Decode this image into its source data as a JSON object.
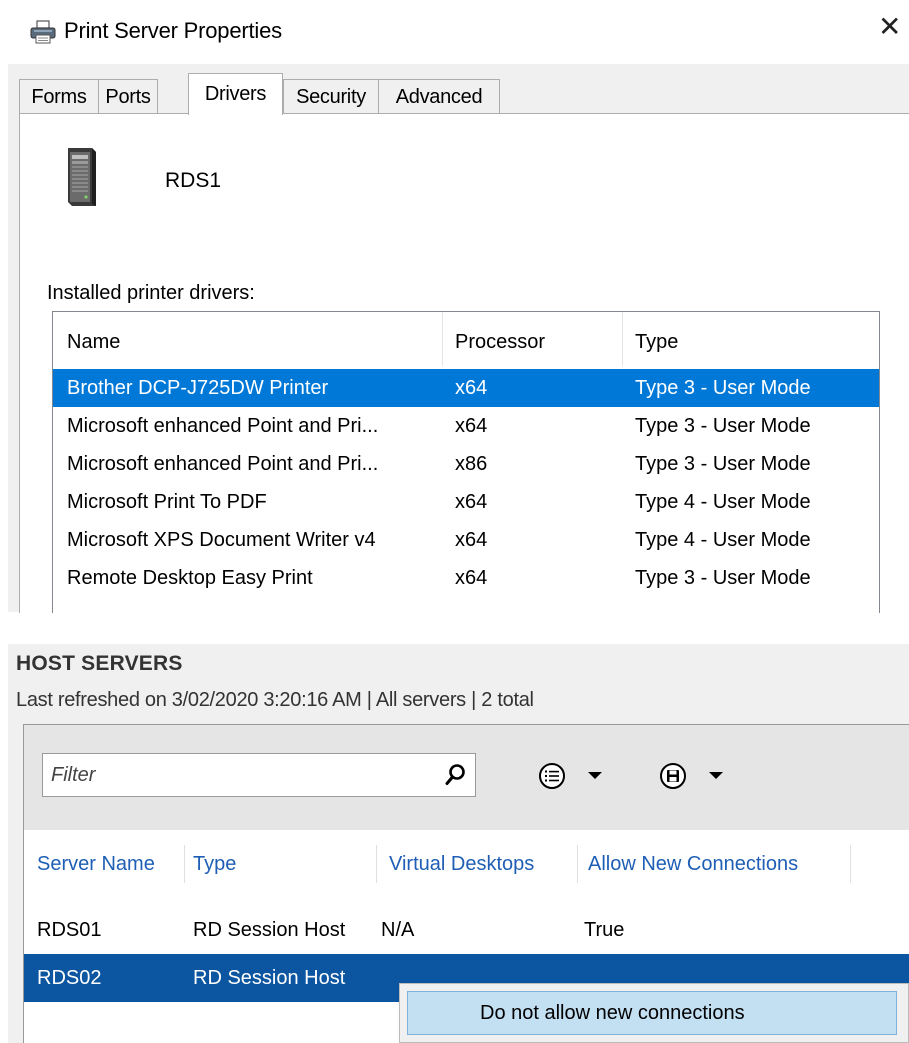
{
  "dialog": {
    "title": "Print Server Properties",
    "close_glyph": "✕",
    "tabs": [
      "Forms",
      "Ports",
      "Drivers",
      "Security",
      "Advanced"
    ],
    "active_tab": "Drivers",
    "server_name": "RDS1",
    "installed_label": "Installed printer drivers:",
    "columns": [
      "Name",
      "Processor",
      "Type"
    ],
    "drivers": [
      {
        "name": "Brother DCP-J725DW Printer",
        "processor": "x64",
        "type": "Type 3 - User Mode",
        "selected": true
      },
      {
        "name": "Microsoft enhanced Point and Pri...",
        "processor": "x64",
        "type": "Type 3 - User Mode"
      },
      {
        "name": "Microsoft enhanced Point and Pri...",
        "processor": "x86",
        "type": "Type 3 - User Mode"
      },
      {
        "name": "Microsoft Print To PDF",
        "processor": "x64",
        "type": "Type 4 - User Mode"
      },
      {
        "name": "Microsoft XPS Document Writer v4",
        "processor": "x64",
        "type": "Type 4 - User Mode"
      },
      {
        "name": "Remote Desktop Easy Print",
        "processor": "x64",
        "type": "Type 3 - User Mode"
      }
    ],
    "icons": {
      "title": "printer-icon",
      "server": "server-tower-icon",
      "close": "close-icon"
    },
    "colors": {
      "selection": "#0078d7"
    }
  },
  "host_servers": {
    "title": "HOST SERVERS",
    "subtitle": "Last refreshed on 3/02/2020 3:20:16 AM | All servers  | 2 total",
    "filter_placeholder": "Filter",
    "columns": [
      "Server Name",
      "Type",
      "Virtual Desktops",
      "Allow New Connections"
    ],
    "rows": [
      {
        "server": "RDS01",
        "type": "RD Session Host",
        "virtual_desktops": "N/A",
        "allow": "True"
      },
      {
        "server": "RDS02",
        "type": "RD Session Host",
        "virtual_desktops": "",
        "allow": "",
        "selected": true
      }
    ],
    "context_menu": [
      "Do not allow new connections"
    ],
    "icons": {
      "search": "search-icon",
      "columns": "list-options-icon",
      "save": "save-icon",
      "dropdown": "caret-down-icon"
    },
    "colors": {
      "selection": "#0c55a0",
      "header_link": "#1e5fb5"
    }
  }
}
